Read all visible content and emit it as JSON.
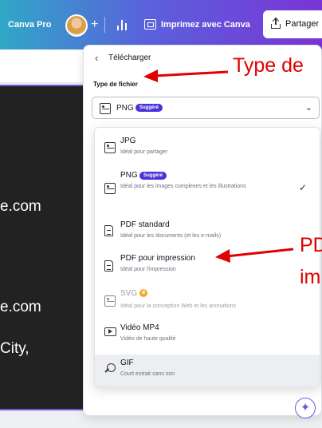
{
  "topbar": {
    "pro_label": "Canva Pro",
    "plus": "+",
    "print_label": "Imprimez avec Canva",
    "share_label": "Partager"
  },
  "design": {
    "lines": [
      "e.com",
      "e.com",
      "City,"
    ]
  },
  "panel": {
    "back": "‹",
    "title": "Télécharger",
    "file_type_label": "Type de fichier",
    "selected": "PNG",
    "selected_badge": "Suggéré",
    "chevron": "⌄"
  },
  "formats": [
    {
      "name": "JPG",
      "desc": "Idéal pour partager",
      "icon": "image-icon"
    },
    {
      "name": "PNG",
      "badge": "Suggéré",
      "desc": "Idéal pour les images complexes et les illustrations",
      "icon": "image-icon",
      "selected": true
    },
    {
      "name": "PDF standard",
      "desc": "Idéal pour les documents (et les e-mails)",
      "icon": "document-icon"
    },
    {
      "name": "PDF pour impression",
      "desc": "Idéal pour l'impression",
      "icon": "document-icon"
    },
    {
      "name": "SVG",
      "desc": "Idéal pour la conception Web et les animations",
      "icon": "image-icon",
      "pro": true
    },
    {
      "name": "Vidéo MP4",
      "desc": "Vidéo de haute qualité",
      "icon": "video-icon"
    },
    {
      "name": "GIF",
      "desc": "Court extrait sans son",
      "icon": "gif-icon"
    }
  ],
  "check_mark": "✓",
  "annotations": {
    "type_label": "Type de",
    "pdf_label_1": "PD",
    "pdf_label_2": "im"
  },
  "colors": {
    "annotation": "#e00000",
    "brand_purple": "#7a34d6",
    "badge": "#4a33d8"
  }
}
